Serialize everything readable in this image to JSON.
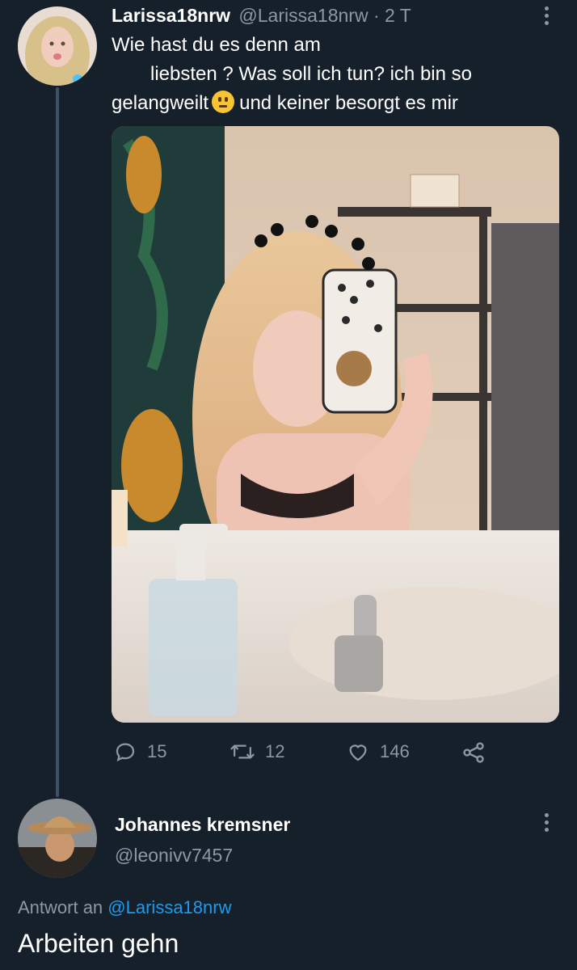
{
  "tweet": {
    "author_name": "Larissa18nrw",
    "author_handle": "@Larissa18nrw",
    "separator": "·",
    "timestamp": "2 T",
    "text_line1": "Wie hast du es denn am",
    "text_line2": "liebsten ? Was soll ich tun? ich bin so",
    "text_line3a": "gelangweilt",
    "text_line3b": "und keiner besorgt es mir",
    "emoji": "neutral-face-emoji",
    "stats": {
      "replies": "15",
      "retweets": "12",
      "likes": "146"
    }
  },
  "reply": {
    "author_name": "Johannes kremsner",
    "author_handle": "@leonivv7457",
    "reply_to_prefix": "Antwort an",
    "reply_to_handle": "@Larissa18nrw",
    "text": "Arbeiten gehn"
  },
  "colors": {
    "background": "#15202b",
    "muted": "#8b98a5",
    "accent": "#1d9bf0",
    "thread_line": "#3d5466"
  }
}
